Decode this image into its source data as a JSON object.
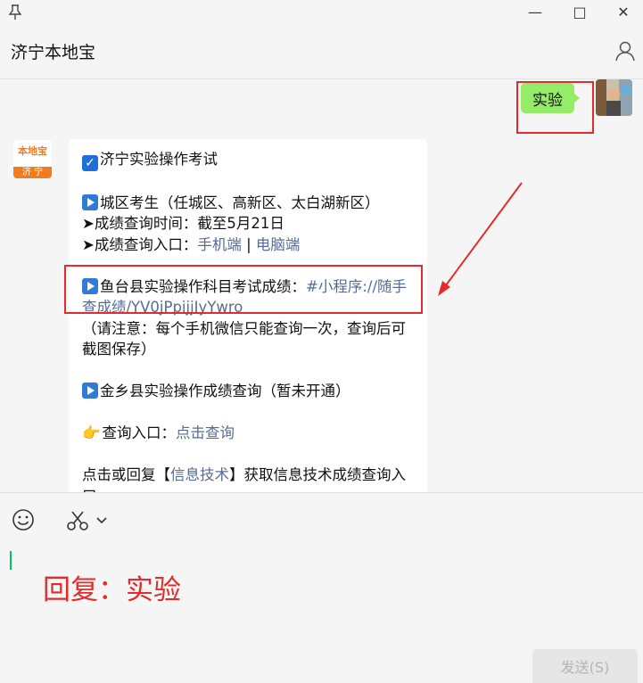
{
  "window": {
    "pin_icon": "pin-icon",
    "minimize_glyph": "—",
    "maximize_glyph": "□",
    "close_glyph": "✕"
  },
  "chat": {
    "title": "济宁本地宝",
    "profile_icon": "person-icon"
  },
  "messages": {
    "sent": {
      "text": "实验"
    },
    "received": {
      "avatar_text_top": "本地宝",
      "avatar_text_bottom": "济 宁",
      "l1": "济宁实验操作考试",
      "l2": "城区考生（任城区、高新区、太白湖新区）",
      "l3": "➤成绩查询时间：截至5月21日",
      "l4_prefix": "➤成绩查询入口：",
      "l4_link1": "手机端",
      "l4_sep": " | ",
      "l4_link2": "电脑端",
      "l5_prefix": "鱼台县实验操作科目考试成绩：",
      "l5_link": "#小程序://随手查成绩/YV0jPpijjIyYwro",
      "l6": "（请注意：每个手机微信只能查询一次，查询后可截图保存）",
      "l7": "金乡县实验操作成绩查询（暂未开通）",
      "l8_prefix": "查询入口：",
      "l8_link": "点击查询",
      "l9_prefix": "点击或回复【",
      "l9_link": "信息技术",
      "l9_suffix": "】获取信息技术成绩查询入口"
    }
  },
  "input": {
    "emoji_icon": "smiley-icon",
    "scissors_icon": "scissors-icon",
    "typed_text": "回复：实验",
    "send_label": "发送(S)"
  },
  "colors": {
    "sent_bubble": "#95ec69",
    "link": "#576b95",
    "annotation": "#e32b2b",
    "cursor": "#07c160"
  }
}
